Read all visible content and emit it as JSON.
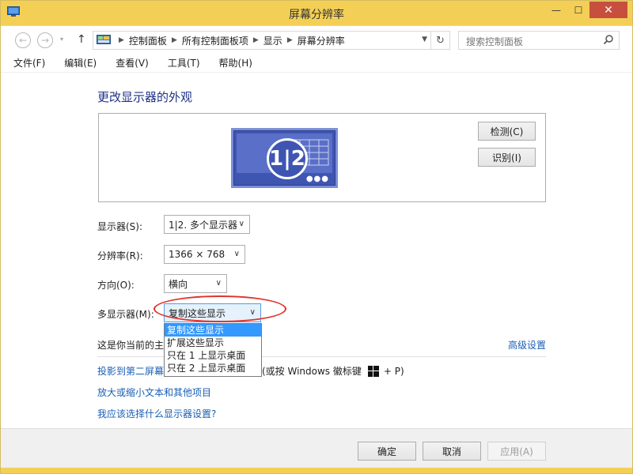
{
  "window": {
    "title": "屏幕分辨率",
    "minimize": "—",
    "maximize": "☐",
    "close": "✕"
  },
  "nav": {
    "back": "←",
    "forward": "→",
    "recent": "▾",
    "up": "↑",
    "breadcrumbs": [
      "控制面板",
      "所有控制面板项",
      "显示",
      "屏幕分辨率"
    ],
    "search_placeholder": "搜索控制面板"
  },
  "menu": [
    "文件(F)",
    "编辑(E)",
    "查看(V)",
    "工具(T)",
    "帮助(H)"
  ],
  "main": {
    "heading": "更改显示器的外观",
    "monitor_label": "1|2",
    "detect_button": "检测(C)",
    "identify_button": "识别(I)",
    "display_label": "显示器(S):",
    "display_value": "1|2. 多个显示器",
    "resolution_label": "分辨率(R):",
    "resolution_value": "1366 × 768",
    "orientation_label": "方向(O):",
    "orientation_value": "横向",
    "multi_label": "多显示器(M):",
    "multi_value": "复制这些显示",
    "multi_options": [
      "复制这些显示",
      "扩展这些显示",
      "只在 1 上显示桌面",
      "只在 2 上显示桌面"
    ],
    "primary_text": "这是你当前的主",
    "advanced_link": "高级设置",
    "project_link": "投影到第二屏幕",
    "project_tail_start": "(或按 Windows 徽标键",
    "project_tail_end": "+ P)",
    "text_size_link": "放大或缩小文本和其他项目",
    "which_settings_link": "我应该选择什么显示器设置?"
  },
  "footer": {
    "ok": "确定",
    "cancel": "取消",
    "apply": "应用(A)"
  },
  "colors": {
    "frame": "#f3cf56",
    "link": "#1a5fb4",
    "heading": "#1e3287",
    "highlight": "#3399ff",
    "annotation": "#e0322c"
  }
}
